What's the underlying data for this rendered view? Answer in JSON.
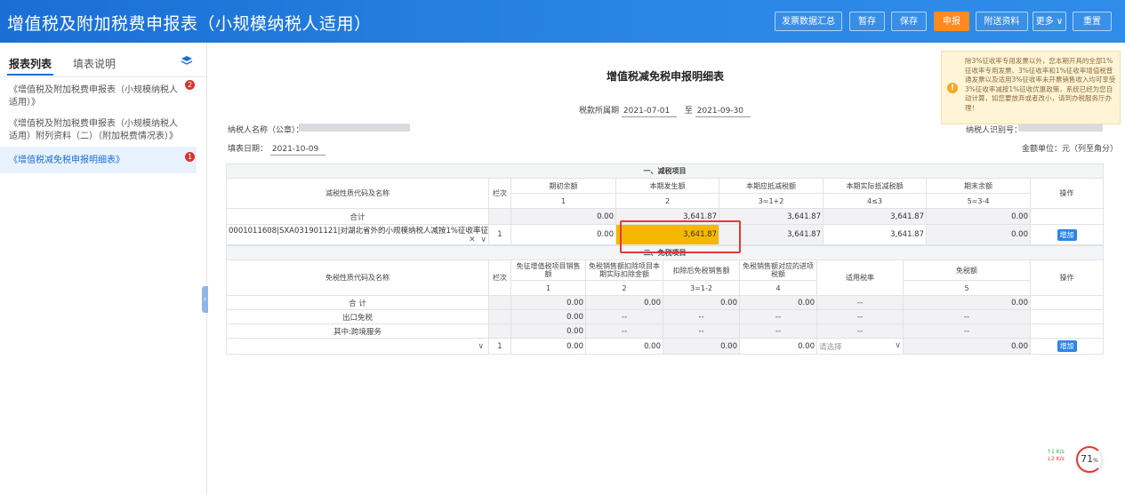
{
  "header": {
    "title": "增值税及附加税费申报表（小规模纳税人适用）",
    "buttons": [
      "发票数据汇总",
      "暂存",
      "保存",
      "申报",
      "附送资料",
      "更多",
      "重置"
    ]
  },
  "sidebar": {
    "tabs": [
      "报表列表",
      "填表说明"
    ],
    "items": [
      {
        "label": "《增值税及附加税费申报表（小规模纳税人适用）》",
        "badge": "2"
      },
      {
        "label": "《增值税及附加税费申报表（小规模纳税人适用）附列资料（二）（附加税费情况表）》"
      },
      {
        "label": "《增值税减免税申报明细表》",
        "badge": "1"
      }
    ]
  },
  "main": {
    "title": "增值税减免税申报明细表",
    "period_label": "税款所属期",
    "period_from": "2021-07-01",
    "period_to_label": "至",
    "period_to": "2021-09-30",
    "taxpayer_name_label": "纳税人名称（公章）：",
    "taxpayer_id_label": "纳税人识别号：",
    "fill_date_label": "填表日期：",
    "fill_date": "2021-10-09",
    "unit_label": "金额单位：元（列至角分）"
  },
  "tip": {
    "text": "除3%征收率专用发票以外，您本期开具的全部1%征收率专用发票、3%征收率和1%征收率增值税普通发票以及适用3%征收率未开票销售收入均可享受3%征收率减按1%征收优惠政策，系统已经为您自动计算，如您要放弃或者改小，请到办税服务厅办理！"
  },
  "t1": {
    "section": "一、减税项目",
    "h_name": "减税性质代码及名称",
    "h_col": "栏次",
    "headers": [
      "期初余额",
      "本期发生额",
      "本期应抵减税额",
      "本期实际抵减税额",
      "期末余额"
    ],
    "subheaders": [
      "1",
      "2",
      "3=1+2",
      "4≤3",
      "5=3-4"
    ],
    "h_op": "操作",
    "total_label": "合计",
    "total_values": [
      "0.00",
      "3,641.87",
      "3,641.87",
      "3,641.87",
      "0.00"
    ],
    "row_name": "0001011608|SXA031901121|对湖北省外的小规模纳税人减按1%征收率征",
    "row_col": "1",
    "row_values": [
      "0.00",
      "3,641.87",
      "3,641.87",
      "3,641.87",
      "0.00"
    ],
    "add_label": "增加"
  },
  "t2": {
    "section": "二、免税项目",
    "h_name": "免税性质代码及名称",
    "h_col": "栏次",
    "headers": [
      "免征增值税项目销售额",
      "免税销售额扣除项目本期实际扣除金额",
      "扣除后免税销售额",
      "免税销售额对应的进项税额",
      "适用税率",
      "免税额"
    ],
    "subheaders": [
      "1",
      "2",
      "3=1-2",
      "4",
      "",
      "5"
    ],
    "h_op": "操作",
    "rows": [
      {
        "label": "合  计",
        "values": [
          "0.00",
          "0.00",
          "0.00",
          "0.00",
          "--",
          "0.00"
        ]
      },
      {
        "label": "出口免税",
        "values": [
          "0.00",
          "--",
          "--",
          "--",
          "--",
          "--"
        ]
      },
      {
        "label": "其中:跨境服务",
        "values": [
          "0.00",
          "--",
          "--",
          "--",
          "--",
          "--"
        ]
      }
    ],
    "input_row": {
      "col": "1",
      "values": [
        "0.00",
        "0.00",
        "0.00",
        "0.00"
      ],
      "rate_placeholder": "请选择",
      "exempt": "0.00"
    },
    "add_label": "增加"
  },
  "status": {
    "up": "↑1 K/s",
    "down": "↓2 K/s",
    "percent": "71",
    "percent_unit": "%"
  }
}
